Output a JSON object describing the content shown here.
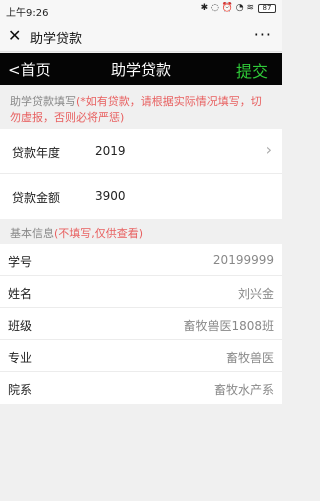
{
  "status": {
    "time": "上午9:26",
    "icons": "✱ ◌ ⏰ ◔ ≋",
    "battery": "87"
  },
  "wechat": {
    "close_icon": "✕",
    "title": "助学贷款",
    "more_icon": "···"
  },
  "nav": {
    "back": "<首页",
    "title": "助学贷款",
    "submit": "提交"
  },
  "loan_section": {
    "title": "助学贷款填写",
    "note": "(*如有贷款，请根据实际情况填写，切勿虚报，否则必将严惩)",
    "rows": [
      {
        "label": "贷款年度",
        "value": "2019"
      },
      {
        "label": "贷款金额",
        "value": "3900"
      }
    ]
  },
  "basic_section": {
    "title": "基本信息",
    "note": "(不填写,仅供查看)",
    "rows": [
      {
        "label": "学号",
        "value": "20199999"
      },
      {
        "label": "姓名",
        "value": "刘兴金"
      },
      {
        "label": "班级",
        "value": "畜牧兽医1808班"
      },
      {
        "label": "专业",
        "value": "畜牧兽医"
      },
      {
        "label": "院系",
        "value": "畜牧水产系"
      }
    ]
  },
  "colors": {
    "nav_bg": "#050505",
    "submit": "#2fca38",
    "note_red": "#e86060",
    "page_bg": "#f0f0f0"
  }
}
